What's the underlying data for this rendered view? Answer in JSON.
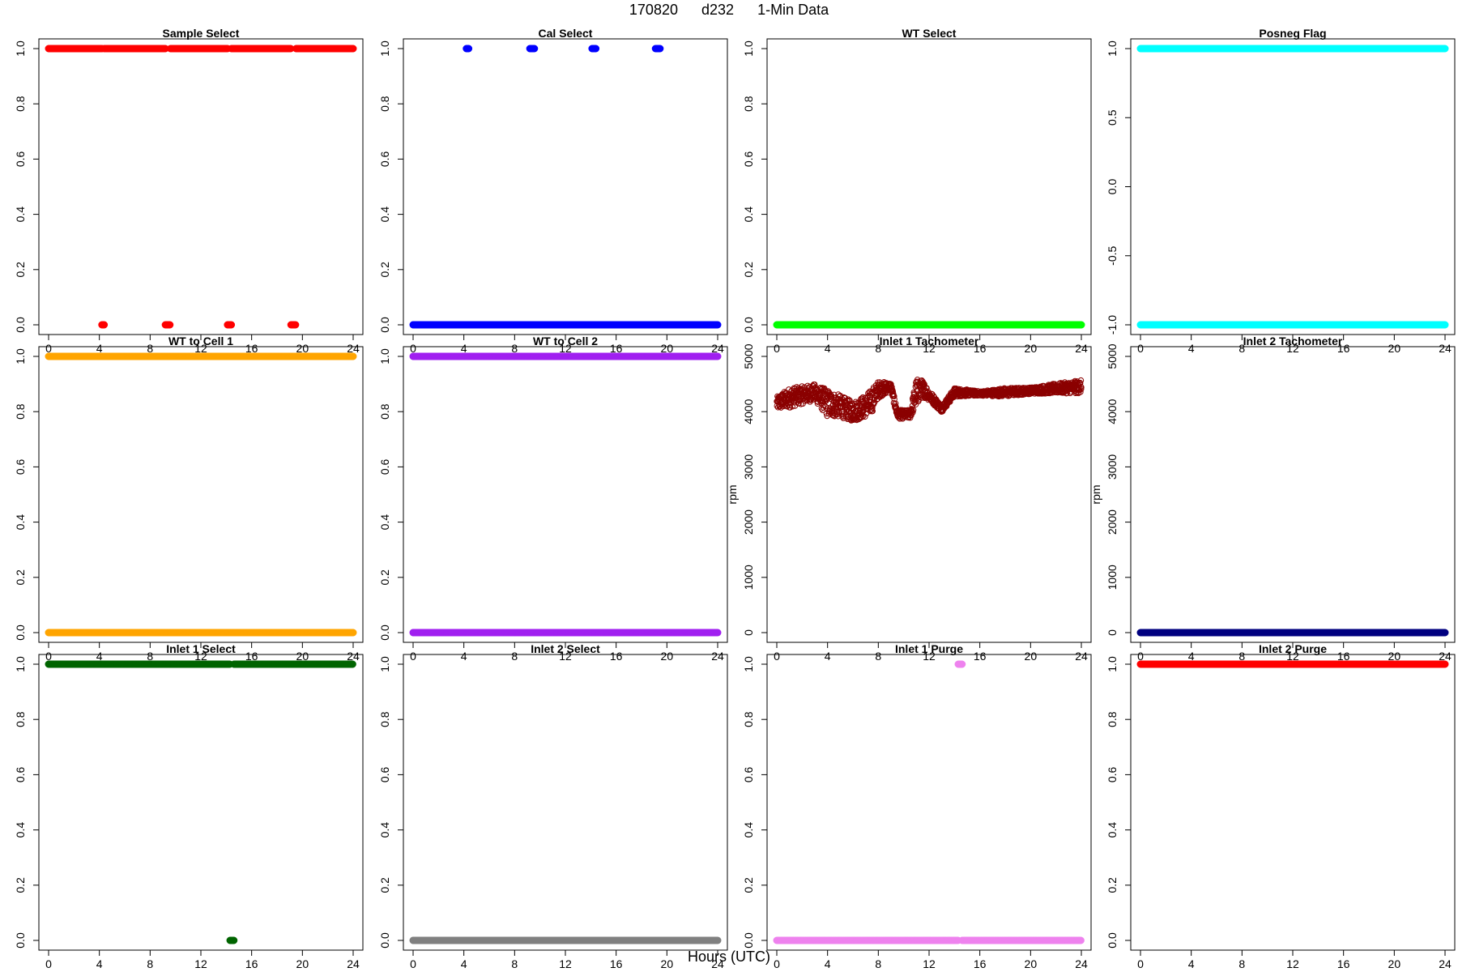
{
  "title": {
    "date": "170820",
    "day": "d232",
    "resolution": "1-Min Data"
  },
  "xlabel": "Hours (UTC)",
  "chart_data": [
    {
      "type": "scatter",
      "title": "Sample Select",
      "color": "#ff0000",
      "xlim": [
        0,
        24
      ],
      "ylim": [
        0,
        1
      ],
      "xticks": [
        0,
        4,
        8,
        12,
        16,
        20,
        24
      ],
      "yticks": [
        0,
        0.2,
        0.4,
        0.6,
        0.8,
        1.0
      ],
      "ytick_labels": [
        "0.0",
        "0.2",
        "0.4",
        "0.6",
        "0.8",
        "1.0"
      ],
      "ylabel": "",
      "marker": "filled",
      "series": [
        {
          "segments": [
            [
              0,
              4.2,
              1
            ],
            [
              4.4,
              9.2,
              1
            ],
            [
              9.6,
              14.1,
              1
            ],
            [
              14.4,
              19.1,
              1
            ],
            [
              19.5,
              24,
              1
            ],
            [
              4.2,
              4.4,
              0
            ],
            [
              9.2,
              9.6,
              0
            ],
            [
              14.1,
              14.4,
              0
            ],
            [
              19.1,
              19.5,
              0
            ]
          ]
        }
      ]
    },
    {
      "type": "scatter",
      "title": "Cal Select",
      "color": "#0000ff",
      "xlim": [
        0,
        24
      ],
      "ylim": [
        0,
        1
      ],
      "xticks": [
        0,
        4,
        8,
        12,
        16,
        20,
        24
      ],
      "yticks": [
        0,
        0.2,
        0.4,
        0.6,
        0.8,
        1.0
      ],
      "ytick_labels": [
        "0.0",
        "0.2",
        "0.4",
        "0.6",
        "0.8",
        "1.0"
      ],
      "ylabel": "",
      "marker": "filled",
      "series": [
        {
          "segments": [
            [
              0,
              24,
              0
            ],
            [
              4.2,
              4.4,
              1
            ],
            [
              9.2,
              9.6,
              1
            ],
            [
              14.1,
              14.4,
              1
            ],
            [
              19.1,
              19.5,
              1
            ]
          ]
        }
      ]
    },
    {
      "type": "scatter",
      "title": "WT Select",
      "color": "#00ff00",
      "xlim": [
        0,
        24
      ],
      "ylim": [
        0,
        1
      ],
      "xticks": [
        0,
        4,
        8,
        12,
        16,
        20,
        24
      ],
      "yticks": [
        0,
        0.2,
        0.4,
        0.6,
        0.8,
        1.0
      ],
      "ytick_labels": [
        "0.0",
        "0.2",
        "0.4",
        "0.6",
        "0.8",
        "1.0"
      ],
      "ylabel": "",
      "marker": "filled",
      "series": [
        {
          "segments": [
            [
              0,
              24,
              0
            ]
          ]
        }
      ]
    },
    {
      "type": "scatter",
      "title": "Posneg Flag",
      "color": "#00ffff",
      "xlim": [
        0,
        24
      ],
      "ylim": [
        -1,
        1
      ],
      "xticks": [
        0,
        4,
        8,
        12,
        16,
        20,
        24
      ],
      "yticks": [
        -1,
        -0.5,
        0,
        0.5,
        1
      ],
      "ytick_labels": [
        "-1.0",
        "-0.5",
        "0.0",
        "0.5",
        "1.0"
      ],
      "ylabel": "",
      "marker": "filled",
      "series": [
        {
          "segments": [
            [
              0,
              24,
              1
            ],
            [
              0,
              24,
              -1
            ]
          ]
        }
      ]
    },
    {
      "type": "scatter",
      "title": "WT to Cell 1",
      "color": "#ffa500",
      "xlim": [
        0,
        24
      ],
      "ylim": [
        0,
        1
      ],
      "xticks": [
        0,
        4,
        8,
        12,
        16,
        20,
        24
      ],
      "yticks": [
        0,
        0.2,
        0.4,
        0.6,
        0.8,
        1.0
      ],
      "ytick_labels": [
        "0.0",
        "0.2",
        "0.4",
        "0.6",
        "0.8",
        "1.0"
      ],
      "ylabel": "",
      "marker": "filled",
      "series": [
        {
          "segments": [
            [
              0,
              24,
              1
            ],
            [
              0,
              24,
              0
            ]
          ]
        }
      ]
    },
    {
      "type": "scatter",
      "title": "WT to Cell 2",
      "color": "#a020f0",
      "xlim": [
        0,
        24
      ],
      "ylim": [
        0,
        1
      ],
      "xticks": [
        0,
        4,
        8,
        12,
        16,
        20,
        24
      ],
      "yticks": [
        0,
        0.2,
        0.4,
        0.6,
        0.8,
        1.0
      ],
      "ytick_labels": [
        "0.0",
        "0.2",
        "0.4",
        "0.6",
        "0.8",
        "1.0"
      ],
      "ylabel": "",
      "marker": "filled",
      "series": [
        {
          "segments": [
            [
              0,
              24,
              1
            ],
            [
              0,
              24,
              0
            ]
          ]
        }
      ]
    },
    {
      "type": "scatter",
      "title": "Inlet 1 Tachometer",
      "color": "#8b0000",
      "xlim": [
        0,
        24
      ],
      "ylim": [
        0,
        5000
      ],
      "xticks": [
        0,
        4,
        8,
        12,
        16,
        20,
        24
      ],
      "yticks": [
        0,
        1000,
        2000,
        3000,
        4000,
        5000
      ],
      "ytick_labels": [
        "0",
        "1000",
        "2000",
        "3000",
        "4000",
        "5000"
      ],
      "ylabel": "rpm",
      "marker": "open",
      "series": [
        {
          "profile": [
            [
              0,
              4150,
              120
            ],
            [
              1,
              4250,
              180
            ],
            [
              2,
              4300,
              160
            ],
            [
              3,
              4350,
              150
            ],
            [
              4,
              4150,
              250
            ],
            [
              5,
              4100,
              200
            ],
            [
              6,
              4000,
              180
            ],
            [
              7,
              4100,
              200
            ],
            [
              7.5,
              4200,
              220
            ],
            [
              8,
              4400,
              150
            ],
            [
              9,
              4450,
              80
            ],
            [
              9.5,
              3950,
              80
            ],
            [
              10.5,
              3950,
              80
            ],
            [
              11,
              4350,
              250
            ],
            [
              11.5,
              4420,
              150
            ],
            [
              12,
              4300,
              100
            ],
            [
              13,
              4050,
              60
            ],
            [
              14,
              4350,
              80
            ],
            [
              16,
              4330,
              40
            ],
            [
              18,
              4350,
              80
            ],
            [
              20,
              4380,
              60
            ],
            [
              22,
              4420,
              90
            ],
            [
              24,
              4450,
              120
            ]
          ]
        }
      ]
    },
    {
      "type": "scatter",
      "title": "Inlet 2 Tachometer",
      "color": "#000080",
      "xlim": [
        0,
        24
      ],
      "ylim": [
        0,
        5000
      ],
      "xticks": [
        0,
        4,
        8,
        12,
        16,
        20,
        24
      ],
      "yticks": [
        0,
        1000,
        2000,
        3000,
        4000,
        5000
      ],
      "ytick_labels": [
        "0",
        "1000",
        "2000",
        "3000",
        "4000",
        "5000"
      ],
      "ylabel": "rpm",
      "marker": "filled",
      "series": [
        {
          "segments": [
            [
              0,
              24,
              0
            ]
          ]
        }
      ]
    },
    {
      "type": "scatter",
      "title": "Inlet 1 Select",
      "color": "#006400",
      "xlim": [
        0,
        24
      ],
      "ylim": [
        0,
        1
      ],
      "xticks": [
        0,
        4,
        8,
        12,
        16,
        20,
        24
      ],
      "yticks": [
        0,
        0.2,
        0.4,
        0.6,
        0.8,
        1.0
      ],
      "ytick_labels": [
        "0.0",
        "0.2",
        "0.4",
        "0.6",
        "0.8",
        "1.0"
      ],
      "ylabel": "",
      "marker": "filled",
      "series": [
        {
          "segments": [
            [
              0,
              14.3,
              1
            ],
            [
              14.6,
              24,
              1
            ],
            [
              14.3,
              14.6,
              0
            ]
          ]
        }
      ]
    },
    {
      "type": "scatter",
      "title": "Inlet 2 Select",
      "color": "#808080",
      "xlim": [
        0,
        24
      ],
      "ylim": [
        0,
        1
      ],
      "xticks": [
        0,
        4,
        8,
        12,
        16,
        20,
        24
      ],
      "yticks": [
        0,
        0.2,
        0.4,
        0.6,
        0.8,
        1.0
      ],
      "ytick_labels": [
        "0.0",
        "0.2",
        "0.4",
        "0.6",
        "0.8",
        "1.0"
      ],
      "ylabel": "",
      "marker": "filled",
      "series": [
        {
          "segments": [
            [
              0,
              24,
              0
            ]
          ]
        }
      ]
    },
    {
      "type": "scatter",
      "title": "Inlet 1 Purge",
      "color": "#ee82ee",
      "xlim": [
        0,
        24
      ],
      "ylim": [
        0,
        1
      ],
      "xticks": [
        0,
        4,
        8,
        12,
        16,
        20,
        24
      ],
      "yticks": [
        0,
        0.2,
        0.4,
        0.6,
        0.8,
        1.0
      ],
      "ytick_labels": [
        "0.0",
        "0.2",
        "0.4",
        "0.6",
        "0.8",
        "1.0"
      ],
      "ylabel": "",
      "marker": "filled",
      "series": [
        {
          "segments": [
            [
              0,
              14.3,
              0
            ],
            [
              14.6,
              24,
              0
            ],
            [
              14.3,
              14.6,
              1
            ]
          ]
        }
      ]
    },
    {
      "type": "scatter",
      "title": "Inlet 2 Purge",
      "color": "#ff0000",
      "xlim": [
        0,
        24
      ],
      "ylim": [
        0,
        1
      ],
      "xticks": [
        0,
        4,
        8,
        12,
        16,
        20,
        24
      ],
      "yticks": [
        0,
        0.2,
        0.4,
        0.6,
        0.8,
        1.0
      ],
      "ytick_labels": [
        "0.0",
        "0.2",
        "0.4",
        "0.6",
        "0.8",
        "1.0"
      ],
      "ylabel": "",
      "marker": "filled",
      "series": [
        {
          "segments": [
            [
              0,
              24,
              1
            ]
          ]
        }
      ]
    }
  ]
}
